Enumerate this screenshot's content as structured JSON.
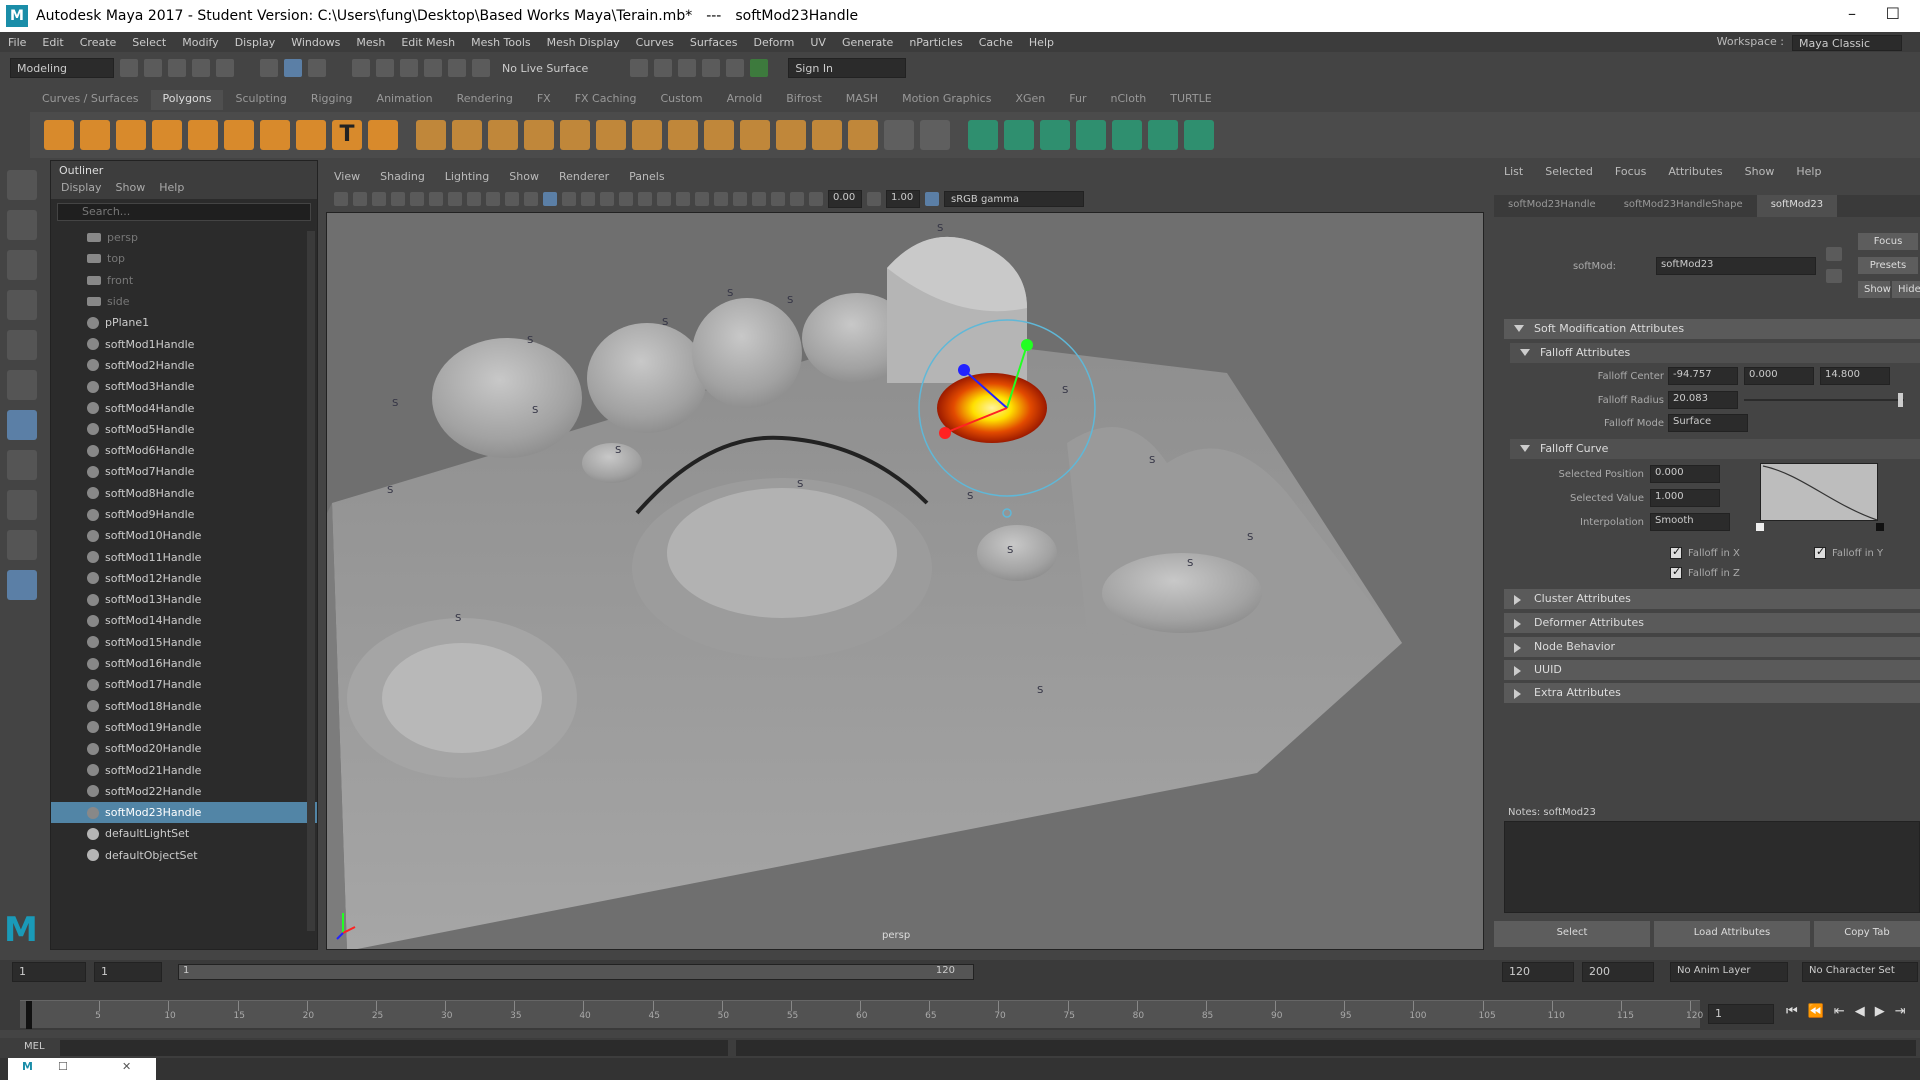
{
  "title": {
    "app": "Autodesk Maya 2017 - Student Version: C:\\Users\\fung\\Desktop\\Based Works Maya\\Terain.mb*",
    "sep": "---",
    "object": "softMod23Handle"
  },
  "menubar": {
    "items": [
      "File",
      "Edit",
      "Create",
      "Select",
      "Modify",
      "Display",
      "Windows",
      "Mesh",
      "Edit Mesh",
      "Mesh Tools",
      "Mesh Display",
      "Curves",
      "Surfaces",
      "Deform",
      "UV",
      "Generate",
      "nParticles",
      "Cache",
      "Help"
    ],
    "workspace_label": "Workspace :",
    "workspace_value": "Maya Classic"
  },
  "statusline": {
    "mode": "Modeling",
    "live_surface": "No Live Surface",
    "sign_in": "Sign In"
  },
  "shelf": {
    "tabs": [
      "Curves / Surfaces",
      "Polygons",
      "Sculpting",
      "Rigging",
      "Animation",
      "Rendering",
      "FX",
      "FX Caching",
      "Custom",
      "Arnold",
      "Bifrost",
      "MASH",
      "Motion Graphics",
      "XGen",
      "Fur",
      "nCloth",
      "TURTLE"
    ],
    "active_tab": "Polygons"
  },
  "outliner": {
    "title": "Outliner",
    "menu": [
      "Display",
      "Show",
      "Help"
    ],
    "search_placeholder": "Search...",
    "items": [
      {
        "label": "persp",
        "kind": "cam"
      },
      {
        "label": "top",
        "kind": "cam"
      },
      {
        "label": "front",
        "kind": "cam"
      },
      {
        "label": "side",
        "kind": "cam"
      },
      {
        "label": "pPlane1",
        "kind": "mesh"
      },
      {
        "label": "softMod1Handle",
        "kind": "handle"
      },
      {
        "label": "softMod2Handle",
        "kind": "handle"
      },
      {
        "label": "softMod3Handle",
        "kind": "handle"
      },
      {
        "label": "softMod4Handle",
        "kind": "handle"
      },
      {
        "label": "softMod5Handle",
        "kind": "handle"
      },
      {
        "label": "softMod6Handle",
        "kind": "handle"
      },
      {
        "label": "softMod7Handle",
        "kind": "handle"
      },
      {
        "label": "softMod8Handle",
        "kind": "handle"
      },
      {
        "label": "softMod9Handle",
        "kind": "handle"
      },
      {
        "label": "softMod10Handle",
        "kind": "handle"
      },
      {
        "label": "softMod11Handle",
        "kind": "handle"
      },
      {
        "label": "softMod12Handle",
        "kind": "handle"
      },
      {
        "label": "softMod13Handle",
        "kind": "handle"
      },
      {
        "label": "softMod14Handle",
        "kind": "handle"
      },
      {
        "label": "softMod15Handle",
        "kind": "handle"
      },
      {
        "label": "softMod16Handle",
        "kind": "handle"
      },
      {
        "label": "softMod17Handle",
        "kind": "handle"
      },
      {
        "label": "softMod18Handle",
        "kind": "handle"
      },
      {
        "label": "softMod19Handle",
        "kind": "handle"
      },
      {
        "label": "softMod20Handle",
        "kind": "handle"
      },
      {
        "label": "softMod21Handle",
        "kind": "handle"
      },
      {
        "label": "softMod22Handle",
        "kind": "handle"
      },
      {
        "label": "softMod23Handle",
        "kind": "handle",
        "selected": true
      },
      {
        "label": "defaultLightSet",
        "kind": "set"
      },
      {
        "label": "defaultObjectSet",
        "kind": "set"
      }
    ]
  },
  "viewport": {
    "menu": [
      "View",
      "Shading",
      "Lighting",
      "Show",
      "Renderer",
      "Panels"
    ],
    "exposure": "0.00",
    "gamma": "1.00",
    "color_space": "sRGB gamma",
    "camera_label": "persp"
  },
  "attribute_editor": {
    "menu": [
      "List",
      "Selected",
      "Focus",
      "Attributes",
      "Show",
      "Help"
    ],
    "tabs": [
      "softMod23Handle",
      "softMod23HandleShape",
      "softMod23"
    ],
    "active_tab": "softMod23",
    "node_label": "softMod:",
    "node_value": "softMod23",
    "focus_btn": "Focus",
    "presets_btn": "Presets",
    "show_btn": "Show",
    "hide_btn": "Hide",
    "section_main": "Soft Modification Attributes",
    "section_falloff": "Falloff Attributes",
    "falloff_center_label": "Falloff Center",
    "falloff_center": [
      "-94.757",
      "0.000",
      "14.800"
    ],
    "falloff_radius_label": "Falloff Radius",
    "falloff_radius": "20.083",
    "falloff_mode_label": "Falloff Mode",
    "falloff_mode": "Surface",
    "section_curve": "Falloff Curve",
    "selected_position_label": "Selected Position",
    "selected_position": "0.000",
    "selected_value_label": "Selected Value",
    "selected_value": "1.000",
    "interpolation_label": "Interpolation",
    "interpolation": "Smooth",
    "falloff_in_x": "Falloff in X",
    "falloff_in_y": "Falloff in Y",
    "falloff_in_z": "Falloff in Z",
    "closed_sections": [
      "Cluster Attributes",
      "Deformer Attributes",
      "Node Behavior",
      "UUID",
      "Extra Attributes"
    ],
    "notes_label": "Notes:  softMod23",
    "bottom_buttons": [
      "Select",
      "Load Attributes",
      "Copy Tab"
    ]
  },
  "timeslider": {
    "start": "1",
    "current_start": "1",
    "range_start_label": "1",
    "range_end_label": "120",
    "end": "120",
    "anim_end": "200",
    "anim_layer": "No Anim Layer",
    "char_set": "No Character Set",
    "current_frame": "1",
    "ticks": [
      "1",
      "5",
      "10",
      "15",
      "20",
      "25",
      "30",
      "35",
      "40",
      "45",
      "50",
      "55",
      "60",
      "65",
      "70",
      "75",
      "80",
      "85",
      "90",
      "95",
      "100",
      "105",
      "110",
      "115",
      "120"
    ]
  },
  "command": {
    "label": "MEL"
  },
  "colors": {
    "accent": "#5285a6",
    "heat_core": "#ffe000",
    "heat_edge": "#c21a00",
    "gizmo_circle": "#5fb8d8"
  }
}
